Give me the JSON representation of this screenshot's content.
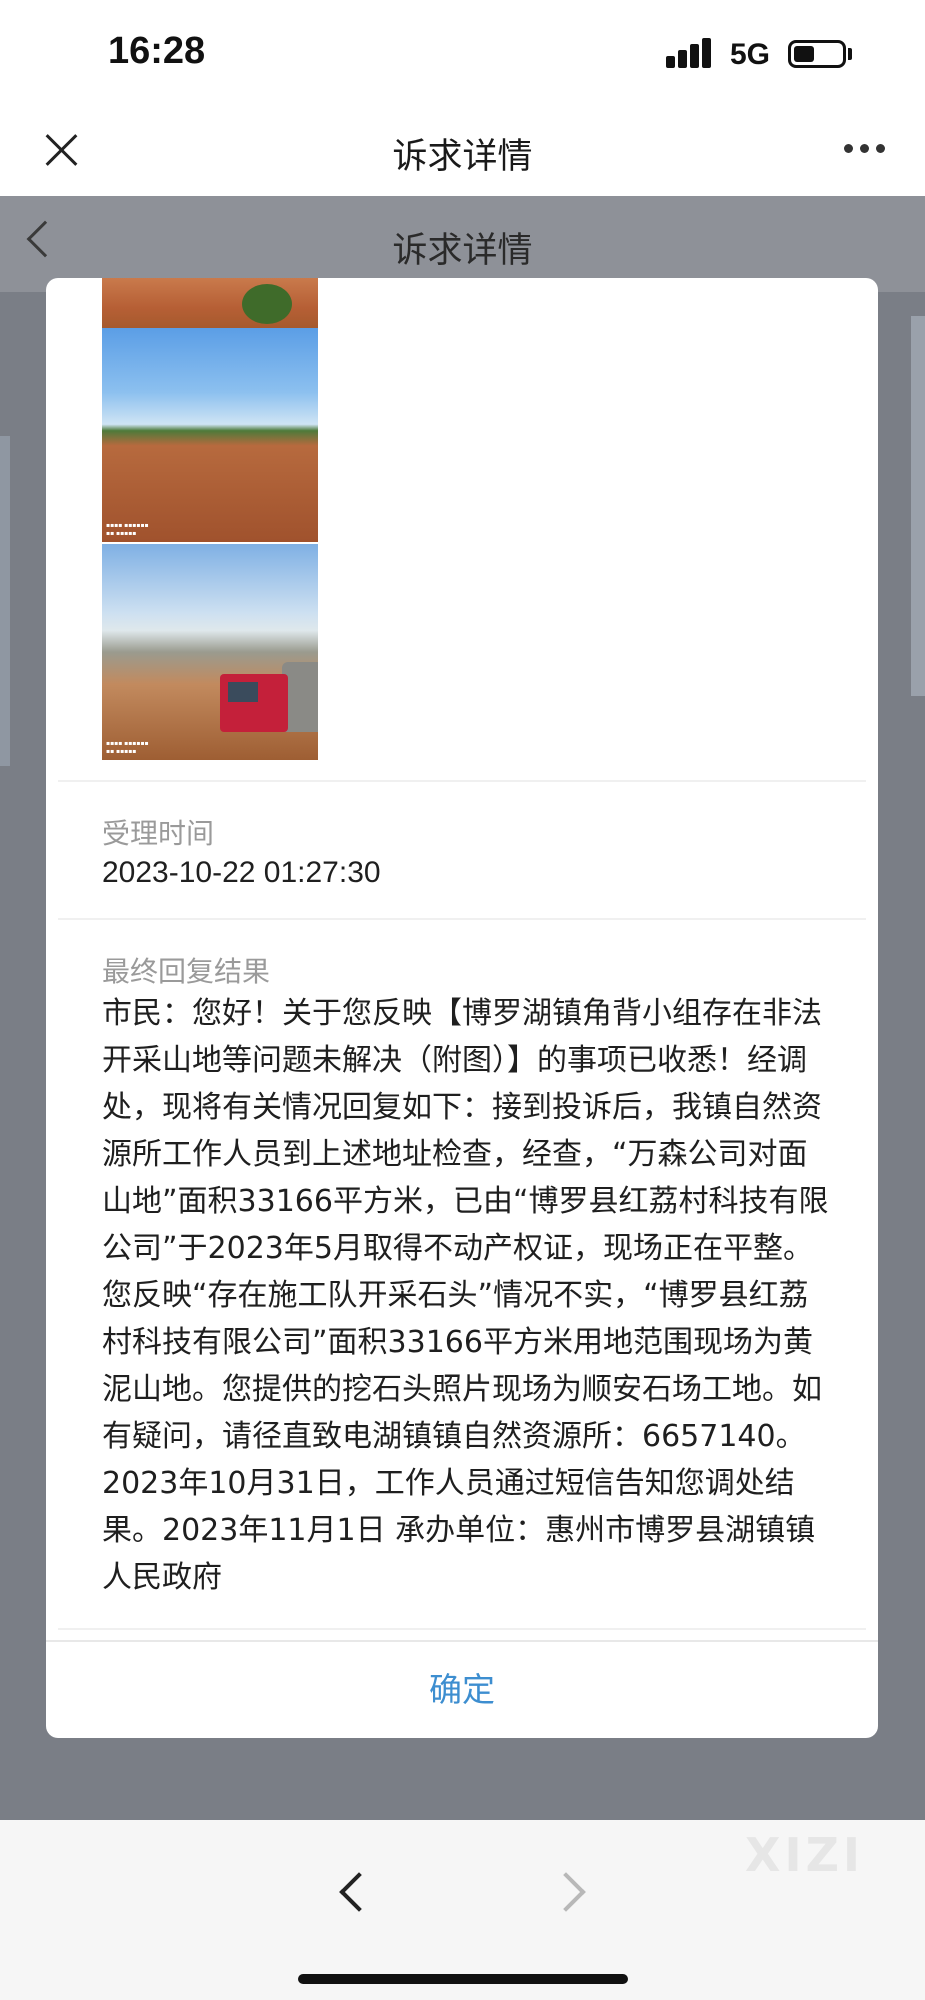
{
  "status_bar": {
    "time": "16:28",
    "network": "5G"
  },
  "top_nav": {
    "title": "诉求详情",
    "close_icon": "close-icon",
    "more_icon": "more-icon"
  },
  "underlying_page": {
    "title": "诉求详情",
    "back_icon": "chevron-left-icon"
  },
  "modal": {
    "accept_time_label": "受理时间",
    "accept_time_value": "2023-10-22 01:27:30",
    "reply_label": "最终回复结果",
    "reply_text": "市民：您好！关于您反映【博罗湖镇角背小组存在非法开采山地等问题未解决（附图）】的事项已收悉！经调处，现将有关情况回复如下：接到投诉后，我镇自然资源所工作人员到上述地址检查，经查，“万森公司对面山地”面积33166平方米，已由“博罗县红荔村科技有限公司”于2023年5月取得不动产权证，现场正在平整。您反映“存在施工队开采石头”情况不实，“博罗县红荔村科技有限公司”面积33166平方米用地范围现场为黄泥山地。您提供的挖石头照片现场为顺安石场工地。如有疑问，请径直致电湖镇镇自然资源所：6657140。 2023年10月31日，工作人员通过短信告知您调处结果。2023年11月1日 承办单位：惠州市博罗县湖镇镇人民政府",
    "confirm_label": "确定"
  },
  "bottom_bar": {
    "back_icon": "chevron-left-icon",
    "forward_icon": "chevron-right-icon",
    "watermark": "XIZI"
  }
}
